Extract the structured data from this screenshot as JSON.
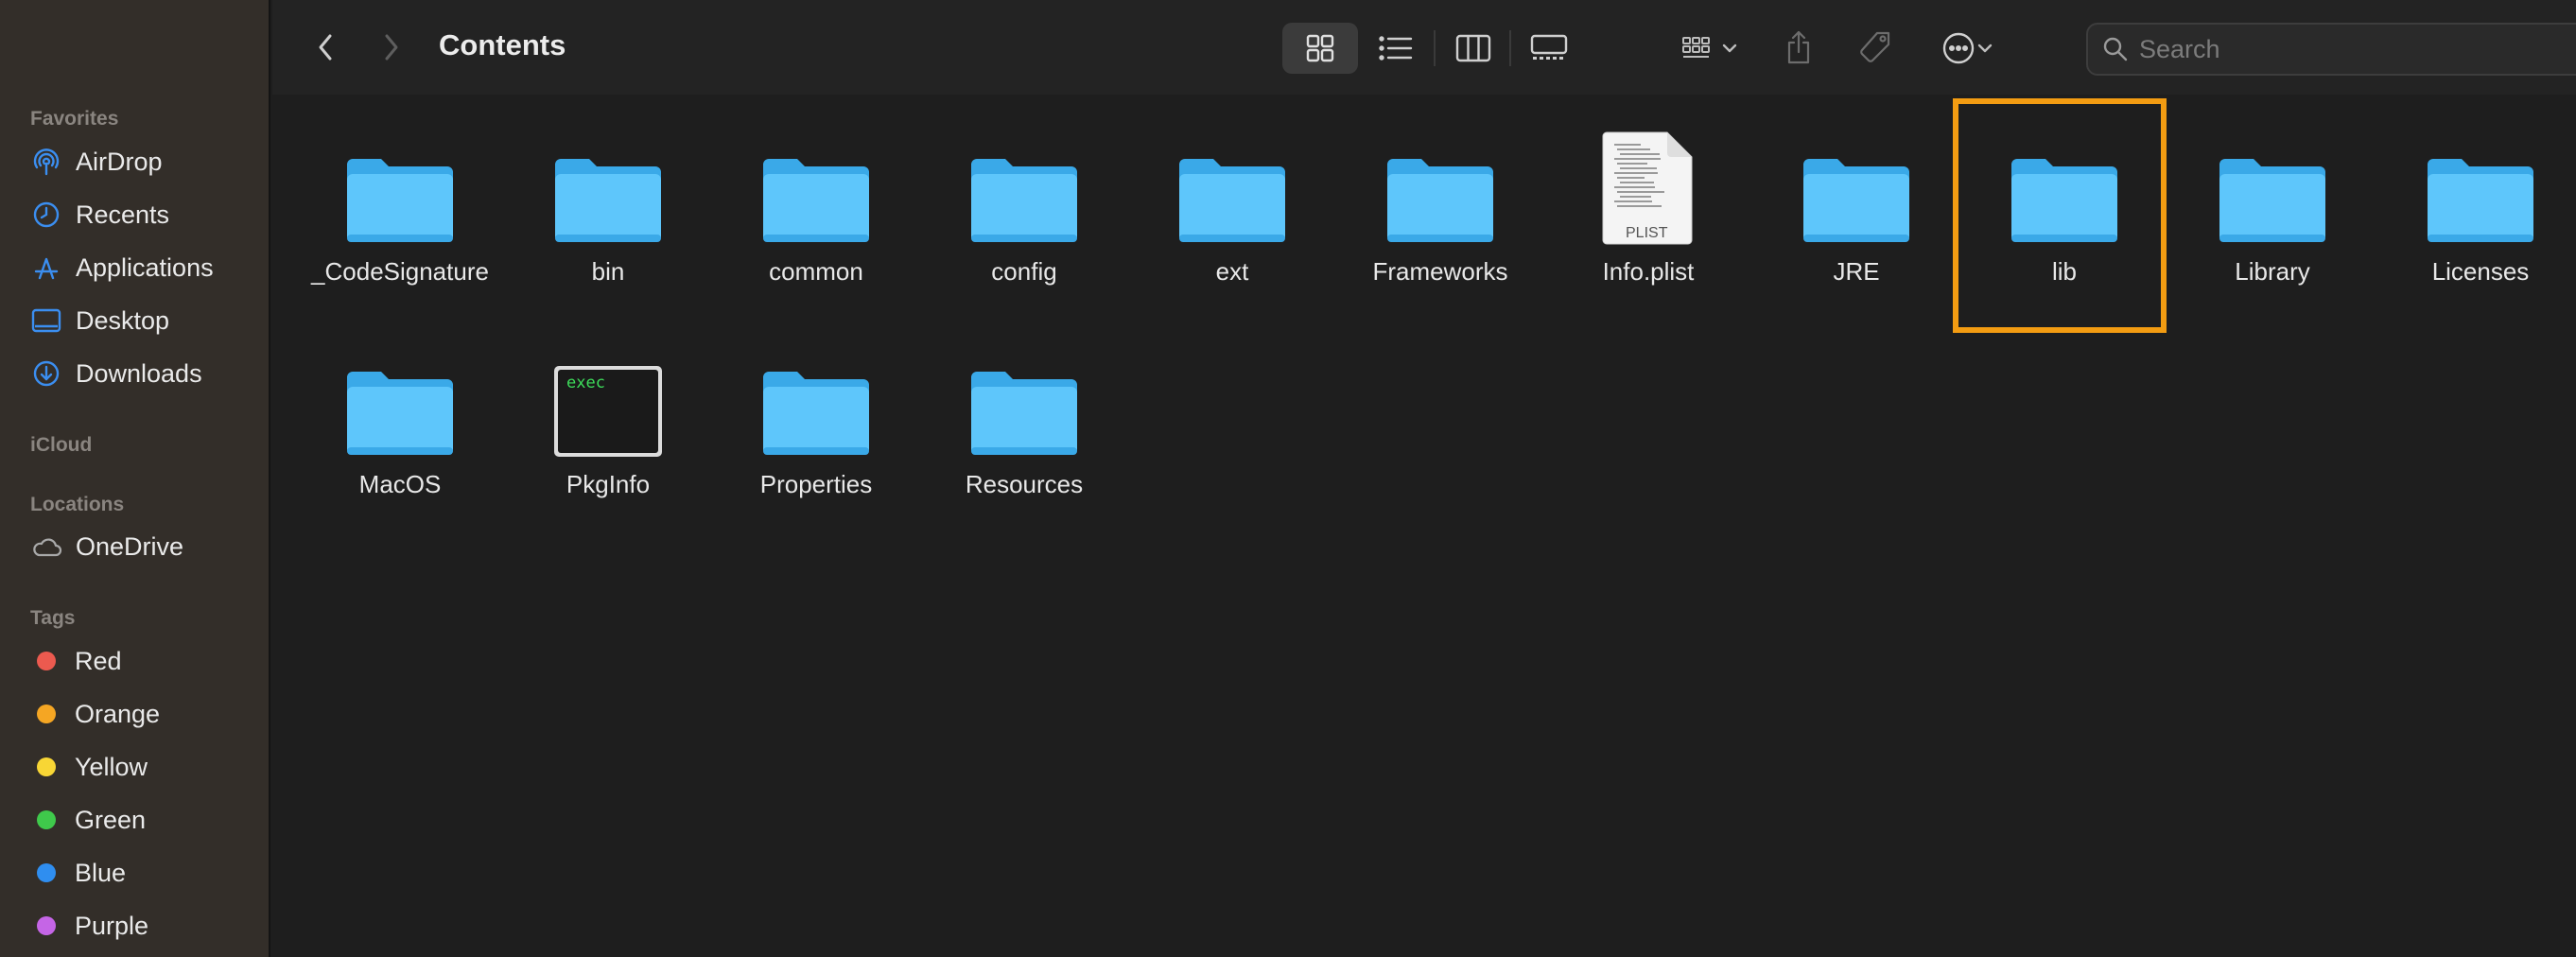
{
  "window": {
    "title": "Contents"
  },
  "sidebar": {
    "sections": {
      "favorites": "Favorites",
      "icloud": "iCloud",
      "locations": "Locations",
      "tags": "Tags"
    },
    "favorites": [
      {
        "label": "AirDrop",
        "icon": "airdrop-icon"
      },
      {
        "label": "Recents",
        "icon": "clock-icon"
      },
      {
        "label": "Applications",
        "icon": "applications-icon"
      },
      {
        "label": "Desktop",
        "icon": "desktop-icon"
      },
      {
        "label": "Downloads",
        "icon": "download-icon"
      }
    ],
    "locations": [
      {
        "label": "OneDrive",
        "icon": "cloud-icon"
      }
    ],
    "tags": [
      {
        "label": "Red",
        "color": "#ec5a4f"
      },
      {
        "label": "Orange",
        "color": "#f5a623"
      },
      {
        "label": "Yellow",
        "color": "#f8d635"
      },
      {
        "label": "Green",
        "color": "#3fc94b"
      },
      {
        "label": "Blue",
        "color": "#2f8ef0"
      },
      {
        "label": "Purple",
        "color": "#c565e6"
      }
    ]
  },
  "toolbar": {
    "search_placeholder": "Search",
    "active_view": "icon-view"
  },
  "files": [
    {
      "name": "_CodeSignature",
      "kind": "folder"
    },
    {
      "name": "bin",
      "kind": "folder"
    },
    {
      "name": "common",
      "kind": "folder"
    },
    {
      "name": "config",
      "kind": "folder"
    },
    {
      "name": "ext",
      "kind": "folder"
    },
    {
      "name": "Frameworks",
      "kind": "folder"
    },
    {
      "name": "Info.plist",
      "kind": "plist",
      "badge": "PLIST"
    },
    {
      "name": "JRE",
      "kind": "folder"
    },
    {
      "name": "lib",
      "kind": "folder",
      "selected": true
    },
    {
      "name": "Library",
      "kind": "folder"
    },
    {
      "name": "Licenses",
      "kind": "folder"
    },
    {
      "name": "MacOS",
      "kind": "folder"
    },
    {
      "name": "PkgInfo",
      "kind": "exec",
      "badge": "exec"
    },
    {
      "name": "Properties",
      "kind": "folder"
    },
    {
      "name": "Resources",
      "kind": "folder"
    }
  ],
  "colors": {
    "folder": "#5ec6fb",
    "folder_dark": "#3aa9e8",
    "selection": "#f39c12",
    "sidebar_accent": "#3b8ef0"
  }
}
